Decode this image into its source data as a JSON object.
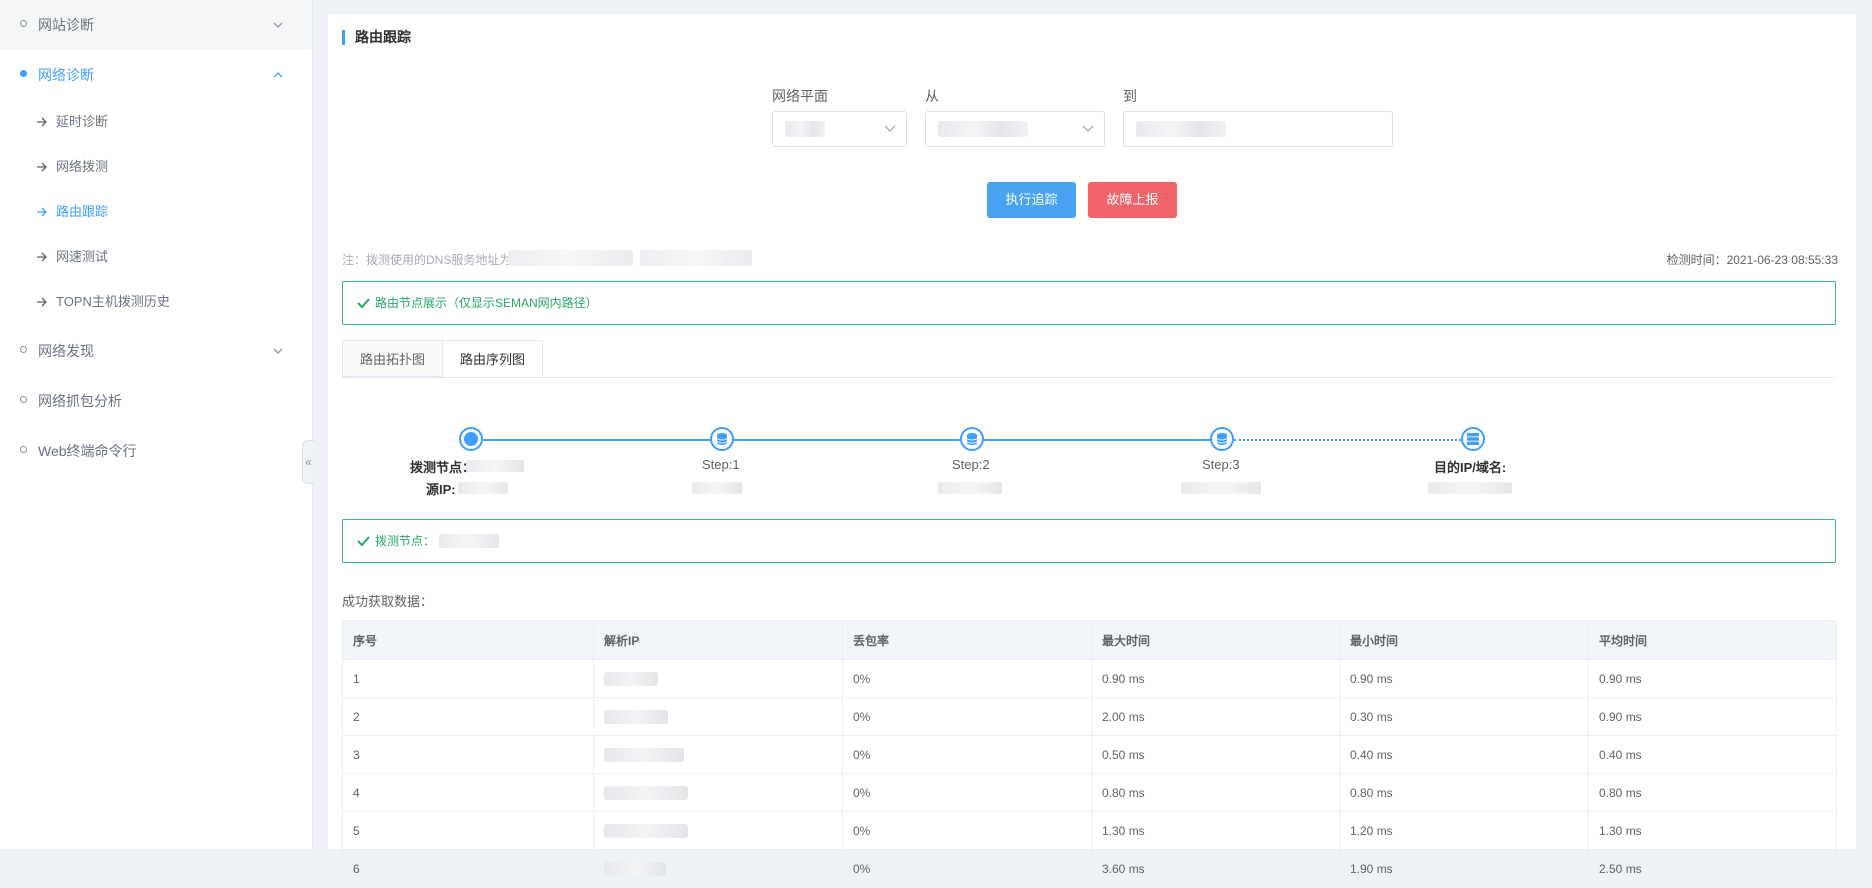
{
  "sidebar": {
    "groups": [
      {
        "label": "网站诊断",
        "active": false,
        "expanded": false
      },
      {
        "label": "网络诊断",
        "active": true,
        "expanded": true
      },
      {
        "label": "网络发现",
        "active": false,
        "expanded": false
      },
      {
        "label": "网络抓包分析",
        "active": false
      },
      {
        "label": "Web终端命令行",
        "active": false
      }
    ],
    "sub_items": [
      {
        "label": "延时诊断",
        "active": false
      },
      {
        "label": "网络拨测",
        "active": false
      },
      {
        "label": "路由跟踪",
        "active": true
      },
      {
        "label": "网速测试",
        "active": false
      },
      {
        "label": "TOPN主机拨测历史",
        "active": false
      }
    ],
    "collapse_glyph": "«"
  },
  "main": {
    "title": "路由跟踪",
    "form": {
      "plane_label": "网络平面",
      "from_label": "从",
      "to_label": "到"
    },
    "buttons": {
      "trace": "执行追踪",
      "report": "故障上报"
    },
    "note": "注：拨测使用的DNS服务地址为",
    "check_time": "检测时间：2021-06-23 08:55:33",
    "route_banner": "路由节点展示（仅显示SEMAN网内路径）",
    "tabs": [
      {
        "label": "路由拓扑图",
        "active": false
      },
      {
        "label": "路由序列图",
        "active": true
      }
    ],
    "route": {
      "source_node_label": "拨测节点：",
      "source_ip_label": "源IP:",
      "steps": [
        "Step:1",
        "Step:2",
        "Step:3"
      ],
      "dest_label": "目的IP/域名:"
    },
    "probe_banner": "拨测节点：",
    "result_title": "成功获取数据：",
    "table": {
      "headers": [
        "序号",
        "解析IP",
        "丢包率",
        "最大时间",
        "最小时间",
        "平均时间"
      ],
      "rows": [
        {
          "no": "1",
          "loss": "0%",
          "max": "0.90 ms",
          "min": "0.90 ms",
          "avg": "0.90 ms"
        },
        {
          "no": "2",
          "loss": "0%",
          "max": "2.00 ms",
          "min": "0.30 ms",
          "avg": "0.90 ms"
        },
        {
          "no": "3",
          "loss": "0%",
          "max": "0.50 ms",
          "min": "0.40 ms",
          "avg": "0.40 ms"
        },
        {
          "no": "4",
          "loss": "0%",
          "max": "0.80 ms",
          "min": "0.80 ms",
          "avg": "0.80 ms"
        },
        {
          "no": "5",
          "loss": "0%",
          "max": "1.30 ms",
          "min": "1.20 ms",
          "avg": "1.30 ms"
        },
        {
          "no": "6",
          "loss": "0%",
          "max": "3.60 ms",
          "min": "1.90 ms",
          "avg": "2.50 ms"
        }
      ]
    }
  },
  "colors": {
    "accent": "#409eff",
    "danger": "#f06469",
    "success": "#3db67c"
  }
}
